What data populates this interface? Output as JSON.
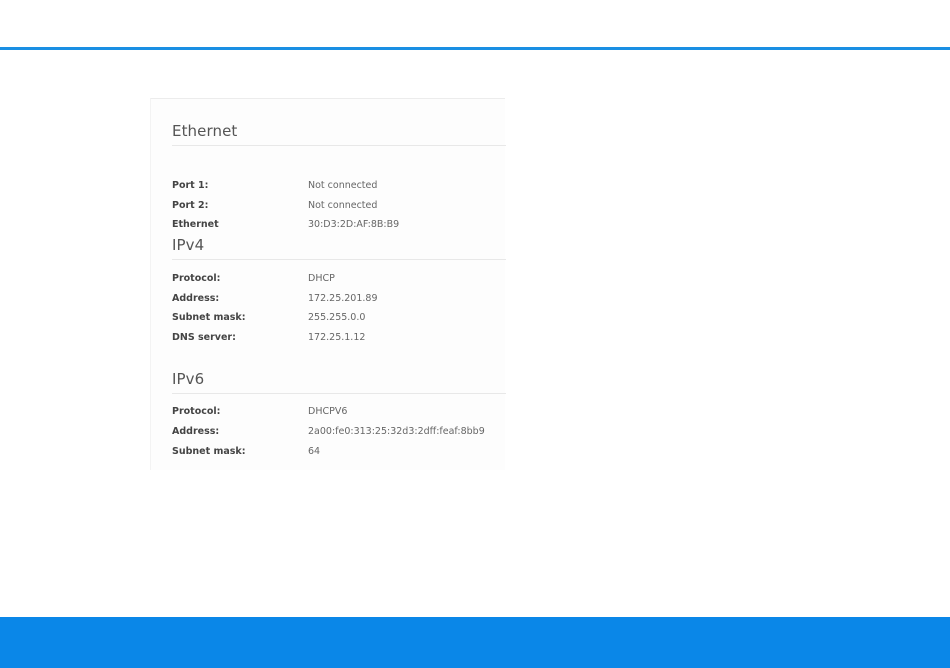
{
  "sections": [
    {
      "title": "Ethernet",
      "rows": [
        {
          "label": "Port 1:",
          "value": "Not connected"
        },
        {
          "label": "Port 2:",
          "value": "Not connected"
        },
        {
          "label": "Ethernet",
          "value": "30:D3:2D:AF:8B:B9"
        }
      ]
    },
    {
      "title": "IPv4",
      "rows": [
        {
          "label": "Protocol:",
          "value": "DHCP"
        },
        {
          "label": "Address:",
          "value": "172.25.201.89"
        },
        {
          "label": "Subnet mask:",
          "value": "255.255.0.0"
        },
        {
          "label": "DNS server:",
          "value": "172.25.1.12"
        }
      ]
    },
    {
      "title": "IPv6",
      "rows": [
        {
          "label": "Protocol:",
          "value": "DHCPV6"
        },
        {
          "label": "Address:",
          "value": "2a00:fe0:313:25:32d3:2dff:feaf:8bb9"
        },
        {
          "label": "Subnet mask:",
          "value": "64"
        }
      ]
    }
  ],
  "colors": {
    "accent": "#1a8fe3",
    "footer": "#0a87e8"
  }
}
